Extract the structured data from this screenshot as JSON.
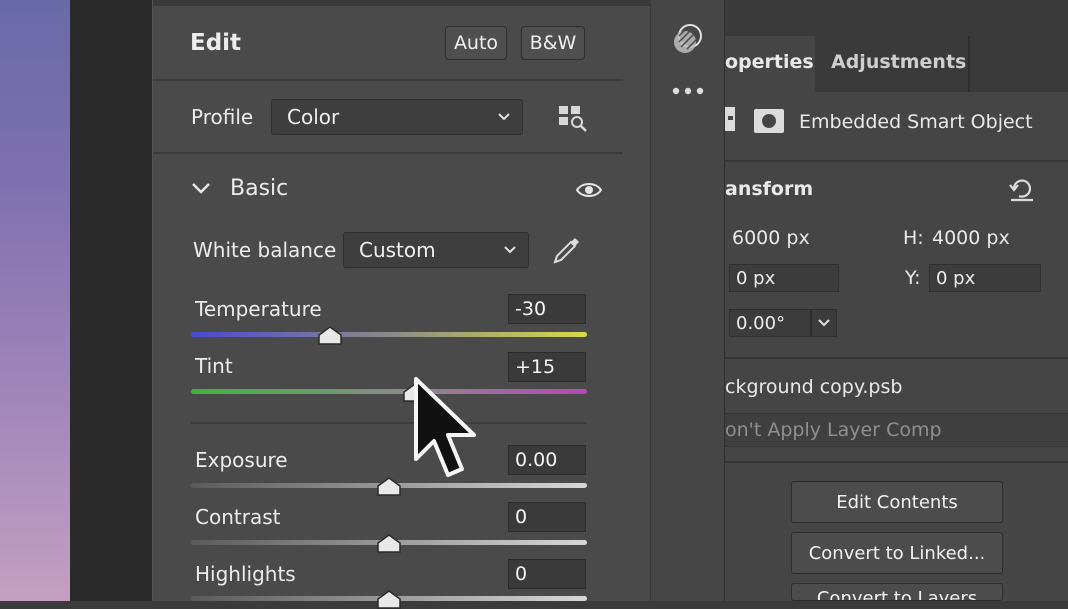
{
  "edit": {
    "title": "Edit",
    "auto_label": "Auto",
    "bw_label": "B&W",
    "profile_label": "Profile",
    "profile_value": "Color",
    "basic_label": "Basic",
    "white_balance_label": "White balance",
    "white_balance_value": "Custom"
  },
  "sliders": [
    {
      "label": "Temperature",
      "value": "-30",
      "position": 0.35
    },
    {
      "label": "Tint",
      "value": "+15",
      "position": 0.565
    },
    {
      "label": "Exposure",
      "value": "0.00",
      "position": 0.5
    },
    {
      "label": "Contrast",
      "value": "0",
      "position": 0.5
    },
    {
      "label": "Highlights",
      "value": "0",
      "position": 0.5
    }
  ],
  "properties": {
    "tab_properties": "operties",
    "tab_adjustments": "Adjustments",
    "object_type": "Embedded Smart Object",
    "transform_label": "ansform",
    "width_value": "6000 px",
    "height_label": "H:",
    "height_value": "4000 px",
    "x_value": "0 px",
    "y_label": "Y:",
    "y_value": "0 px",
    "angle_value": "0.00°",
    "file_name": "ckground copy.psb",
    "layer_comp": "on't Apply Layer Comp",
    "edit_contents_label": "Edit Contents",
    "convert_linked_label": "Convert to Linked...",
    "third_button_label": "Convert to Layers"
  },
  "colors": {
    "panel_bg": "#4a4a4a",
    "temp_start": "#4a4ad0",
    "temp_end": "#d8d848",
    "tint_start": "#3fb33f",
    "tint_end": "#b648b6"
  }
}
